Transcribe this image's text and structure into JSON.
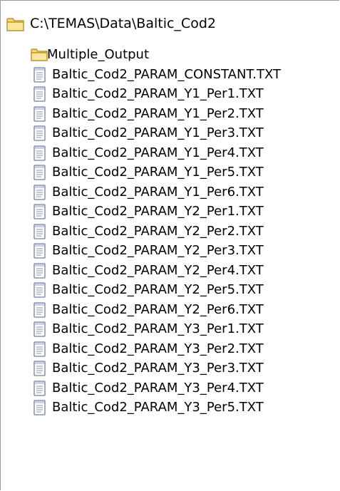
{
  "root": {
    "path": "C:\\TEMAS\\Data\\Baltic_Cod2",
    "icon": "folder-icon"
  },
  "folder_color": "#f2c94a",
  "items": [
    {
      "type": "folder",
      "icon": "folder-icon",
      "label": "Multiple_Output"
    },
    {
      "type": "file",
      "icon": "text-file-icon",
      "label": "Baltic_Cod2_PARAM_CONSTANT.TXT"
    },
    {
      "type": "file",
      "icon": "text-file-icon",
      "label": "Baltic_Cod2_PARAM_Y1_Per1.TXT"
    },
    {
      "type": "file",
      "icon": "text-file-icon",
      "label": "Baltic_Cod2_PARAM_Y1_Per2.TXT"
    },
    {
      "type": "file",
      "icon": "text-file-icon",
      "label": "Baltic_Cod2_PARAM_Y1_Per3.TXT"
    },
    {
      "type": "file",
      "icon": "text-file-icon",
      "label": "Baltic_Cod2_PARAM_Y1_Per4.TXT"
    },
    {
      "type": "file",
      "icon": "text-file-icon",
      "label": "Baltic_Cod2_PARAM_Y1_Per5.TXT"
    },
    {
      "type": "file",
      "icon": "text-file-icon",
      "label": "Baltic_Cod2_PARAM_Y1_Per6.TXT"
    },
    {
      "type": "file",
      "icon": "text-file-icon",
      "label": "Baltic_Cod2_PARAM_Y2_Per1.TXT"
    },
    {
      "type": "file",
      "icon": "text-file-icon",
      "label": "Baltic_Cod2_PARAM_Y2_Per2.TXT"
    },
    {
      "type": "file",
      "icon": "text-file-icon",
      "label": "Baltic_Cod2_PARAM_Y2_Per3.TXT"
    },
    {
      "type": "file",
      "icon": "text-file-icon",
      "label": "Baltic_Cod2_PARAM_Y2_Per4.TXT"
    },
    {
      "type": "file",
      "icon": "text-file-icon",
      "label": "Baltic_Cod2_PARAM_Y2_Per5.TXT"
    },
    {
      "type": "file",
      "icon": "text-file-icon",
      "label": "Baltic_Cod2_PARAM_Y2_Per6.TXT"
    },
    {
      "type": "file",
      "icon": "text-file-icon",
      "label": "Baltic_Cod2_PARAM_Y3_Per1.TXT"
    },
    {
      "type": "file",
      "icon": "text-file-icon",
      "label": "Baltic_Cod2_PARAM_Y3_Per2.TXT"
    },
    {
      "type": "file",
      "icon": "text-file-icon",
      "label": "Baltic_Cod2_PARAM_Y3_Per3.TXT"
    },
    {
      "type": "file",
      "icon": "text-file-icon",
      "label": "Baltic_Cod2_PARAM_Y3_Per4.TXT"
    },
    {
      "type": "file",
      "icon": "text-file-icon",
      "label": "Baltic_Cod2_PARAM_Y3_Per5.TXT"
    }
  ]
}
